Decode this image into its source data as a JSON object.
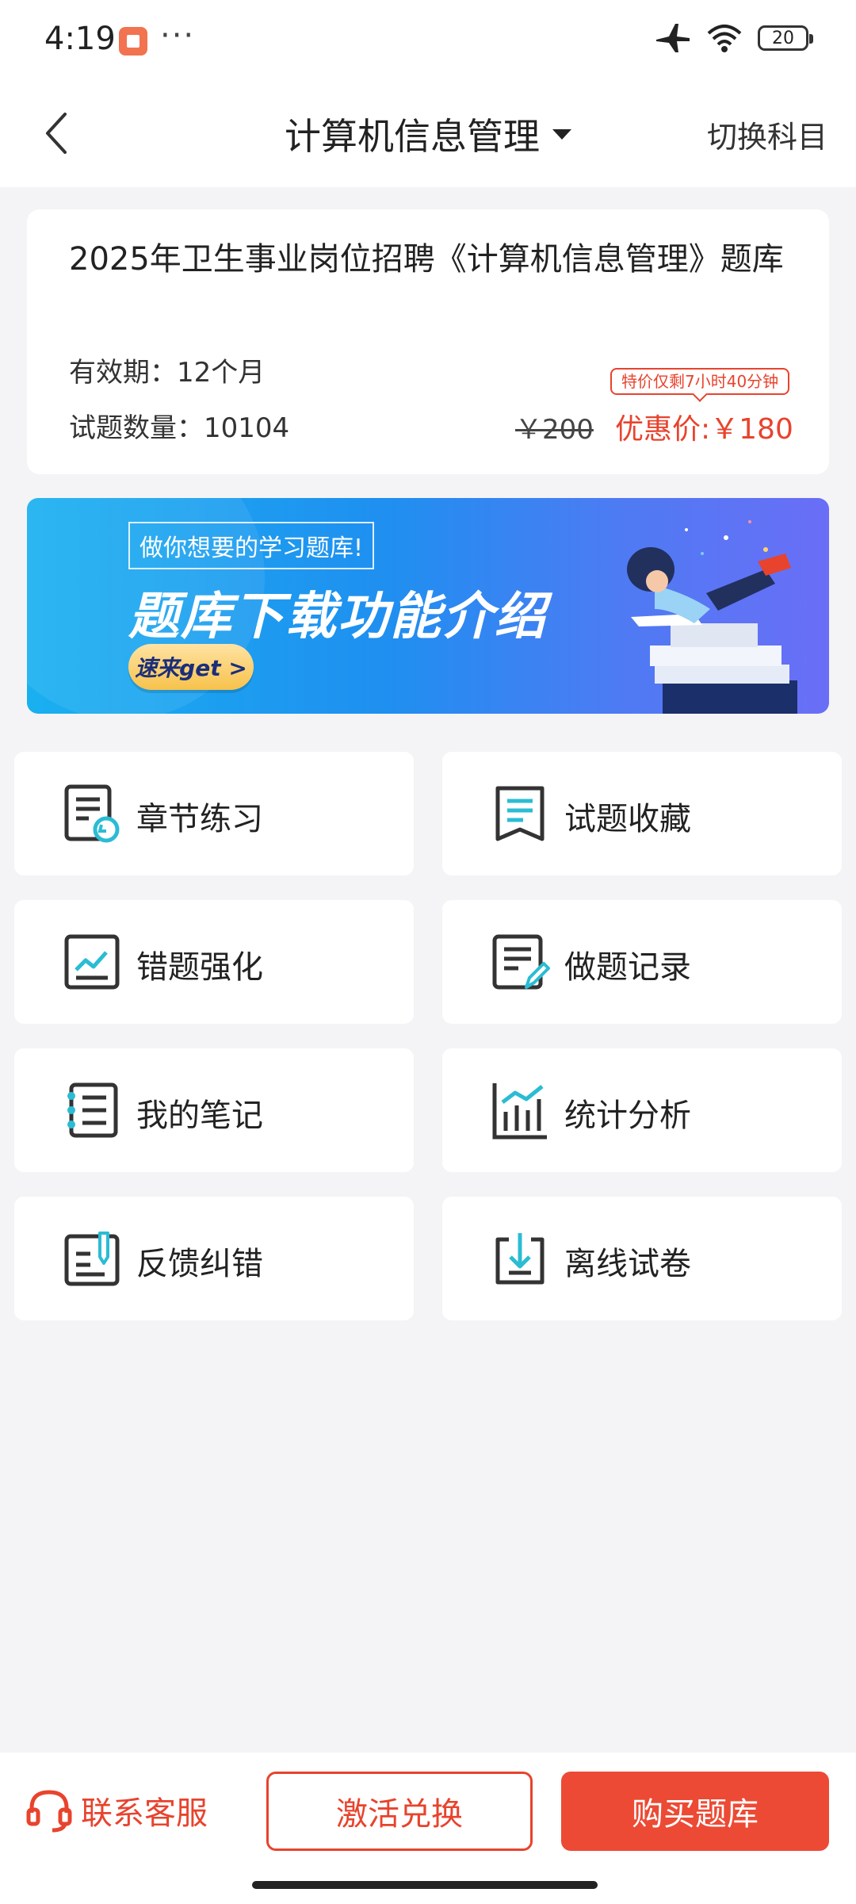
{
  "status_bar": {
    "time": "4:19",
    "dots": "···",
    "battery": "20"
  },
  "header": {
    "title": "计算机信息管理",
    "switch_label": "切换科目"
  },
  "card": {
    "title": "2025年卫生事业岗位招聘《计算机信息管理》题库",
    "validity": "有效期：12个月",
    "count": "试题数量：10104",
    "original_price": "￥200",
    "promo_price": "优惠价:￥180",
    "countdown": "特价仅剩7小时40分钟"
  },
  "banner": {
    "subtitle": "做你想要的学习题库!",
    "title": "题库下载功能介绍",
    "button": "速来get >"
  },
  "grid": [
    {
      "label": "章节练习",
      "icon": "chapter-practice-icon"
    },
    {
      "label": "试题收藏",
      "icon": "bookmark-icon"
    },
    {
      "label": "错题强化",
      "icon": "mistake-chart-icon"
    },
    {
      "label": "做题记录",
      "icon": "record-edit-icon"
    },
    {
      "label": "我的笔记",
      "icon": "notebook-icon"
    },
    {
      "label": "统计分析",
      "icon": "statistics-icon"
    },
    {
      "label": "反馈纠错",
      "icon": "feedback-icon"
    },
    {
      "label": "离线试卷",
      "icon": "download-icon"
    }
  ],
  "bottom": {
    "service": "联系客服",
    "activate": "激活兑换",
    "buy": "购买题库"
  },
  "colors": {
    "accent": "#e8432d",
    "teal": "#2bbcd4",
    "background": "#f4f4f6"
  }
}
